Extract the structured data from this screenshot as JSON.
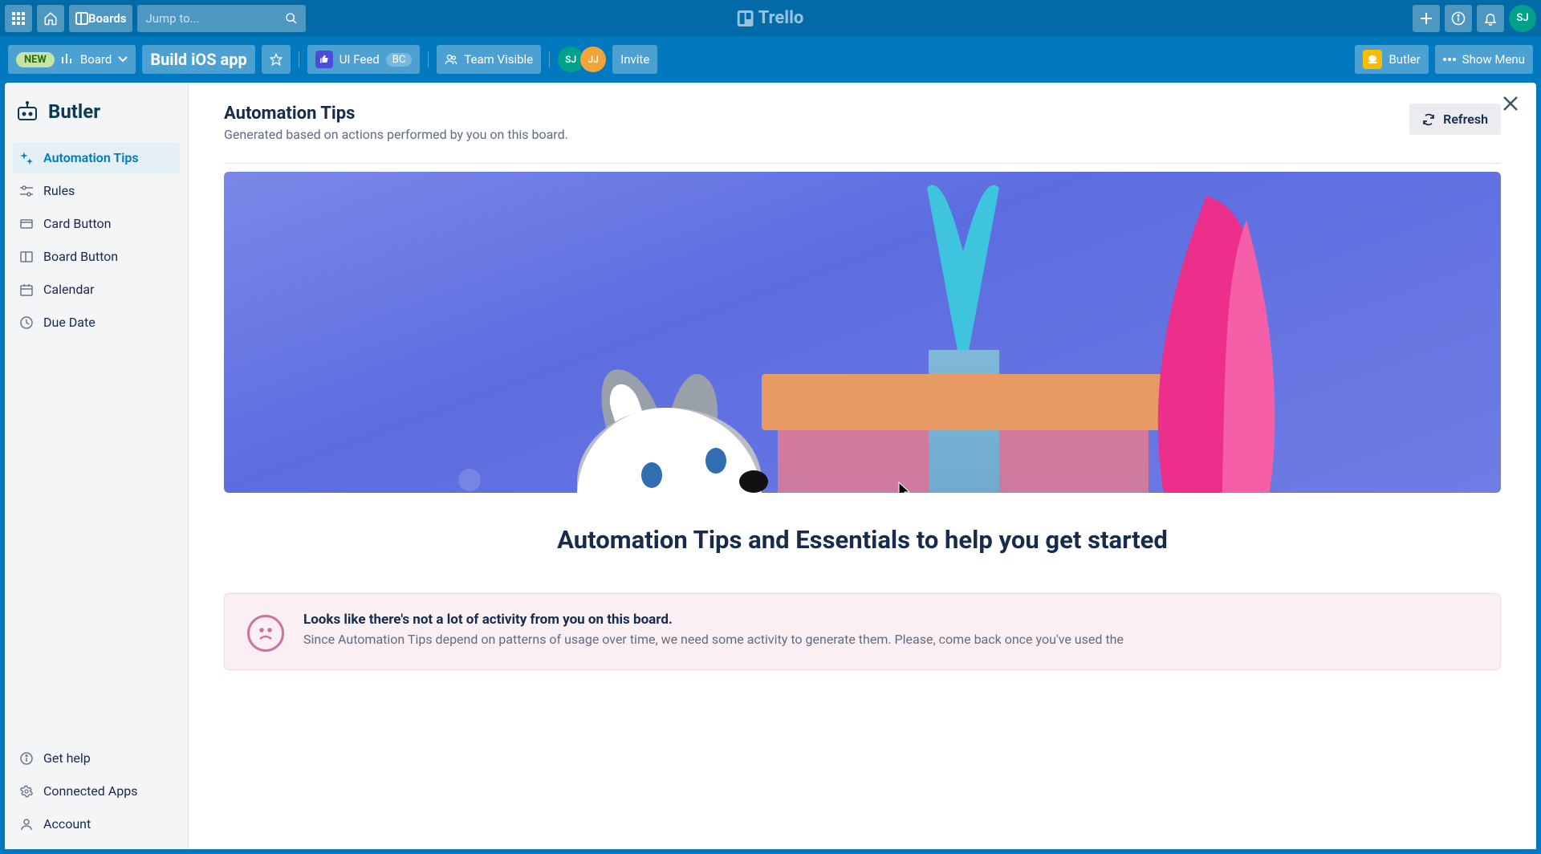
{
  "topbar": {
    "boards_label": "Boards",
    "search_placeholder": "Jump to...",
    "brand": "Trello",
    "avatar_initials": "SJ"
  },
  "boardbar": {
    "new_badge": "NEW",
    "board_switch": "Board",
    "board_title": "Build iOS app",
    "ui_feed": "UI Feed",
    "bc_badge": "BC",
    "visibility": "Team Visible",
    "members": [
      "SJ",
      "JJ"
    ],
    "invite": "Invite",
    "butler": "Butler",
    "show_menu": "Show Menu"
  },
  "sidebar": {
    "title": "Butler",
    "nav": [
      {
        "label": "Automation Tips"
      },
      {
        "label": "Rules"
      },
      {
        "label": "Card Button"
      },
      {
        "label": "Board Button"
      },
      {
        "label": "Calendar"
      },
      {
        "label": "Due Date"
      }
    ],
    "bottom": [
      {
        "label": "Get help"
      },
      {
        "label": "Connected Apps"
      },
      {
        "label": "Account"
      }
    ]
  },
  "content": {
    "heading": "Automation Tips",
    "subheading": "Generated based on actions performed by you on this board.",
    "refresh": "Refresh",
    "big_title": "Automation Tips and Essentials to help you get started",
    "notice_title": "Looks like there's not a lot of activity from you on this board.",
    "notice_body": "Since Automation Tips depend on patterns of usage over time, we need some activity to generate them. Please, come back once you've used the"
  }
}
